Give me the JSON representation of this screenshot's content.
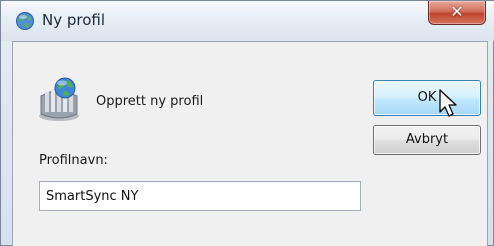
{
  "window": {
    "title": "Ny profil",
    "close_icon": "close-icon",
    "title_icon": "profile-globe-icon"
  },
  "content": {
    "icon": "profile-icon",
    "create_text": "Opprett ny profil",
    "profile_name_label": "Profilnavn:",
    "profile_name_value": "SmartSync NY"
  },
  "buttons": {
    "ok_label": "OK",
    "cancel_label": "Avbryt"
  },
  "colors": {
    "close_button": "#c84a34",
    "ok_button_border": "#3c7fb1"
  }
}
